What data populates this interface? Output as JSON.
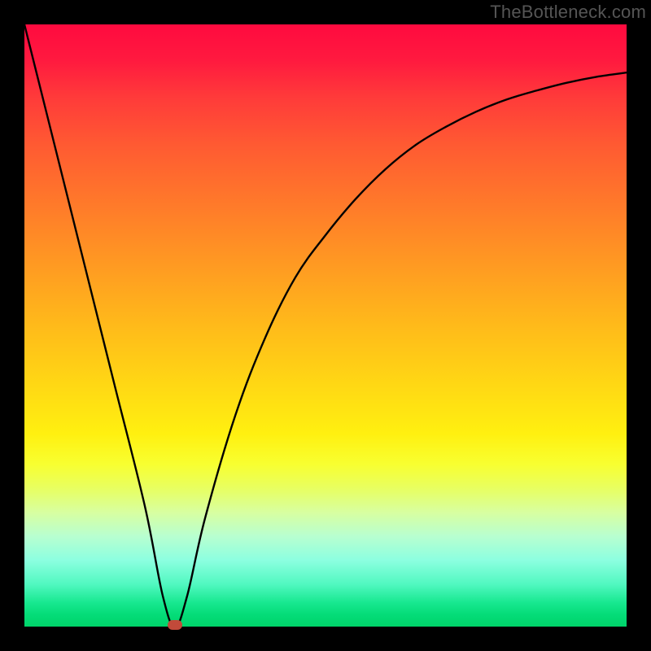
{
  "watermark": "TheBottleneck.com",
  "colors": {
    "frame": "#000000",
    "curve": "#000000",
    "marker": "#c24a3a",
    "watermark": "#555555"
  },
  "chart_data": {
    "type": "line",
    "title": "",
    "xlabel": "",
    "ylabel": "",
    "xlim": [
      0,
      100
    ],
    "ylim": [
      0,
      100
    ],
    "grid": false,
    "legend": false,
    "gradient_meaning": "vertical value (bottleneck severity): top=high/red, bottom=low/green",
    "series": [
      {
        "name": "bottleneck-curve",
        "x": [
          0,
          5,
          10,
          15,
          20,
          23,
          25,
          27,
          30,
          35,
          40,
          45,
          50,
          55,
          60,
          65,
          70,
          75,
          80,
          85,
          90,
          95,
          100
        ],
        "values": [
          100,
          80,
          60,
          40,
          20,
          5,
          0,
          5,
          18,
          35,
          48,
          58,
          65,
          71,
          76,
          80,
          83,
          85.5,
          87.5,
          89,
          90.3,
          91.3,
          92
        ]
      }
    ],
    "marker": {
      "x": 25,
      "y": 0,
      "name": "optimal-point"
    }
  }
}
